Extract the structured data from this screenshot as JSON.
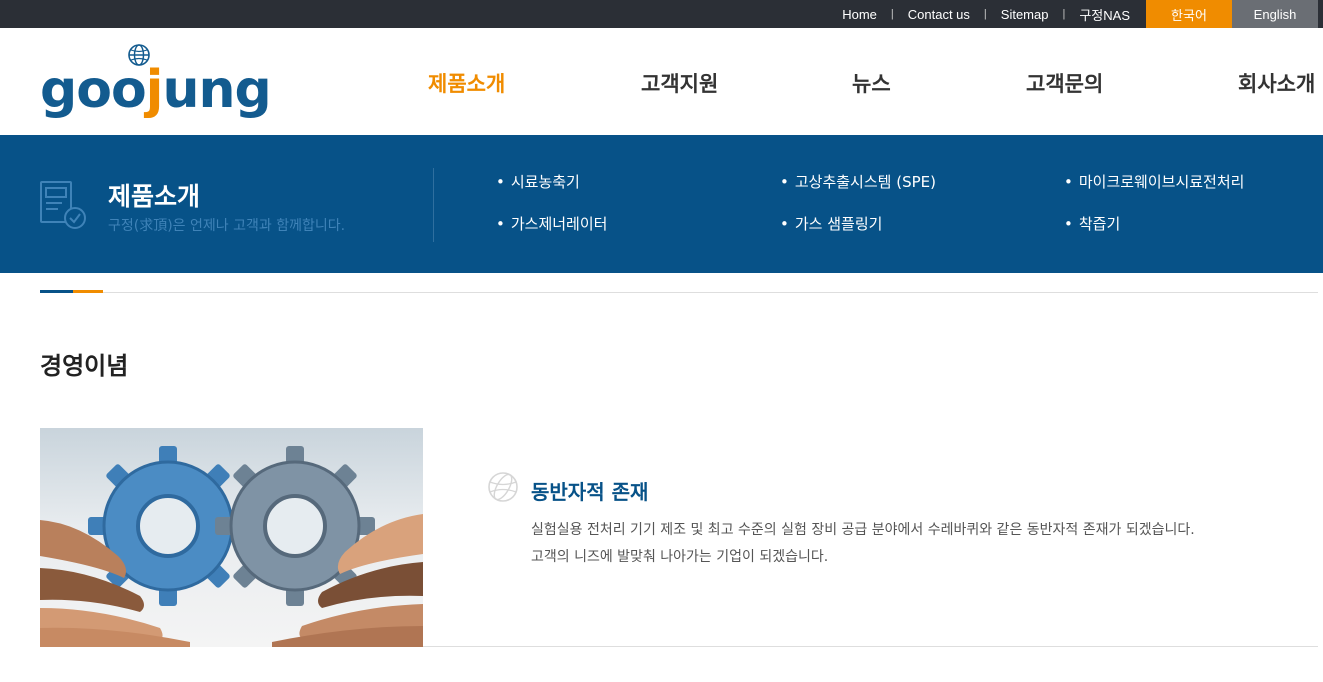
{
  "topbar": {
    "links": [
      "Home",
      "Contact us",
      "Sitemap",
      "구정NAS"
    ],
    "lang_ko": "한국어",
    "lang_en": "English"
  },
  "logo": {
    "part1": "goo",
    "part2": "j",
    "part3": "ung"
  },
  "nav": {
    "items": [
      "제품소개",
      "고객지원",
      "뉴스",
      "고객문의",
      "회사소개"
    ],
    "active": "제품소개"
  },
  "banner": {
    "title": "제품소개",
    "subtitle": "구정(求頂)은 언제나 고객과 함께합니다.",
    "submenu": [
      "시료농축기",
      "고상추출시스템 (SPE)",
      "마이크로웨이브시료전처리",
      "가스제너레이터",
      "가스 샘플링기",
      "착즙기"
    ]
  },
  "section": {
    "heading": "경영이념"
  },
  "content": {
    "title": "동반자적 존재",
    "lines": [
      "실험실용 전처리 기기 제조 및 최고 수준의 실험 장비 공급 분야에서 수레바퀴와 같은 동반자적 존재가 되겠습니다.",
      "고객의 니즈에 발맞춰 나아가는 기업이 되겠습니다."
    ]
  },
  "colors": {
    "brand_blue": "#075288",
    "accent_orange": "#f08c00",
    "topbar": "#2b2f36"
  }
}
